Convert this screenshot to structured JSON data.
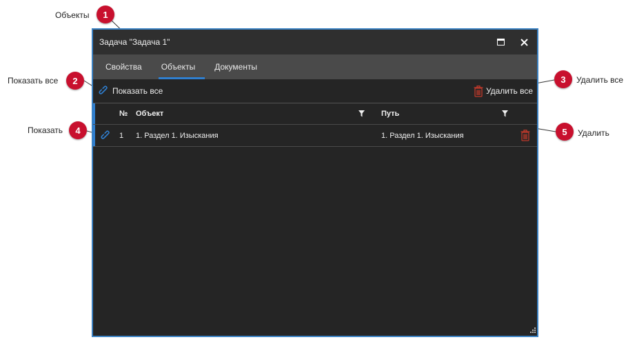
{
  "callouts": [
    {
      "number": "1",
      "label": "Объекты"
    },
    {
      "number": "2",
      "label": "Показать все"
    },
    {
      "number": "3",
      "label": "Удалить все"
    },
    {
      "number": "4",
      "label": "Показать"
    },
    {
      "number": "5",
      "label": "Удалить"
    }
  ],
  "window": {
    "title": "Задача \"Задача  1\"",
    "maximize_icon": "maximize-icon",
    "close_icon": "close-icon"
  },
  "tabs": [
    {
      "label": "Свойства",
      "active": false
    },
    {
      "label": "Объекты",
      "active": true
    },
    {
      "label": "Документы",
      "active": false
    }
  ],
  "toolbar": {
    "show_all_label": "Показать все",
    "show_all_icon": "link-icon",
    "delete_all_label": "Удалить все",
    "delete_all_icon": "trash-icon"
  },
  "grid": {
    "columns": {
      "num": "№",
      "object": "Объект",
      "path": "Путь"
    },
    "filter_icon": "filter-icon",
    "rows": [
      {
        "num": "1",
        "object": "1. Раздел 1. Изыскания",
        "path": "1. Раздел 1. Изыскания"
      }
    ]
  },
  "colors": {
    "accent": "#2f7fd0",
    "badge": "#c8102e",
    "delete": "#c0392b",
    "window_bg": "#252525"
  }
}
